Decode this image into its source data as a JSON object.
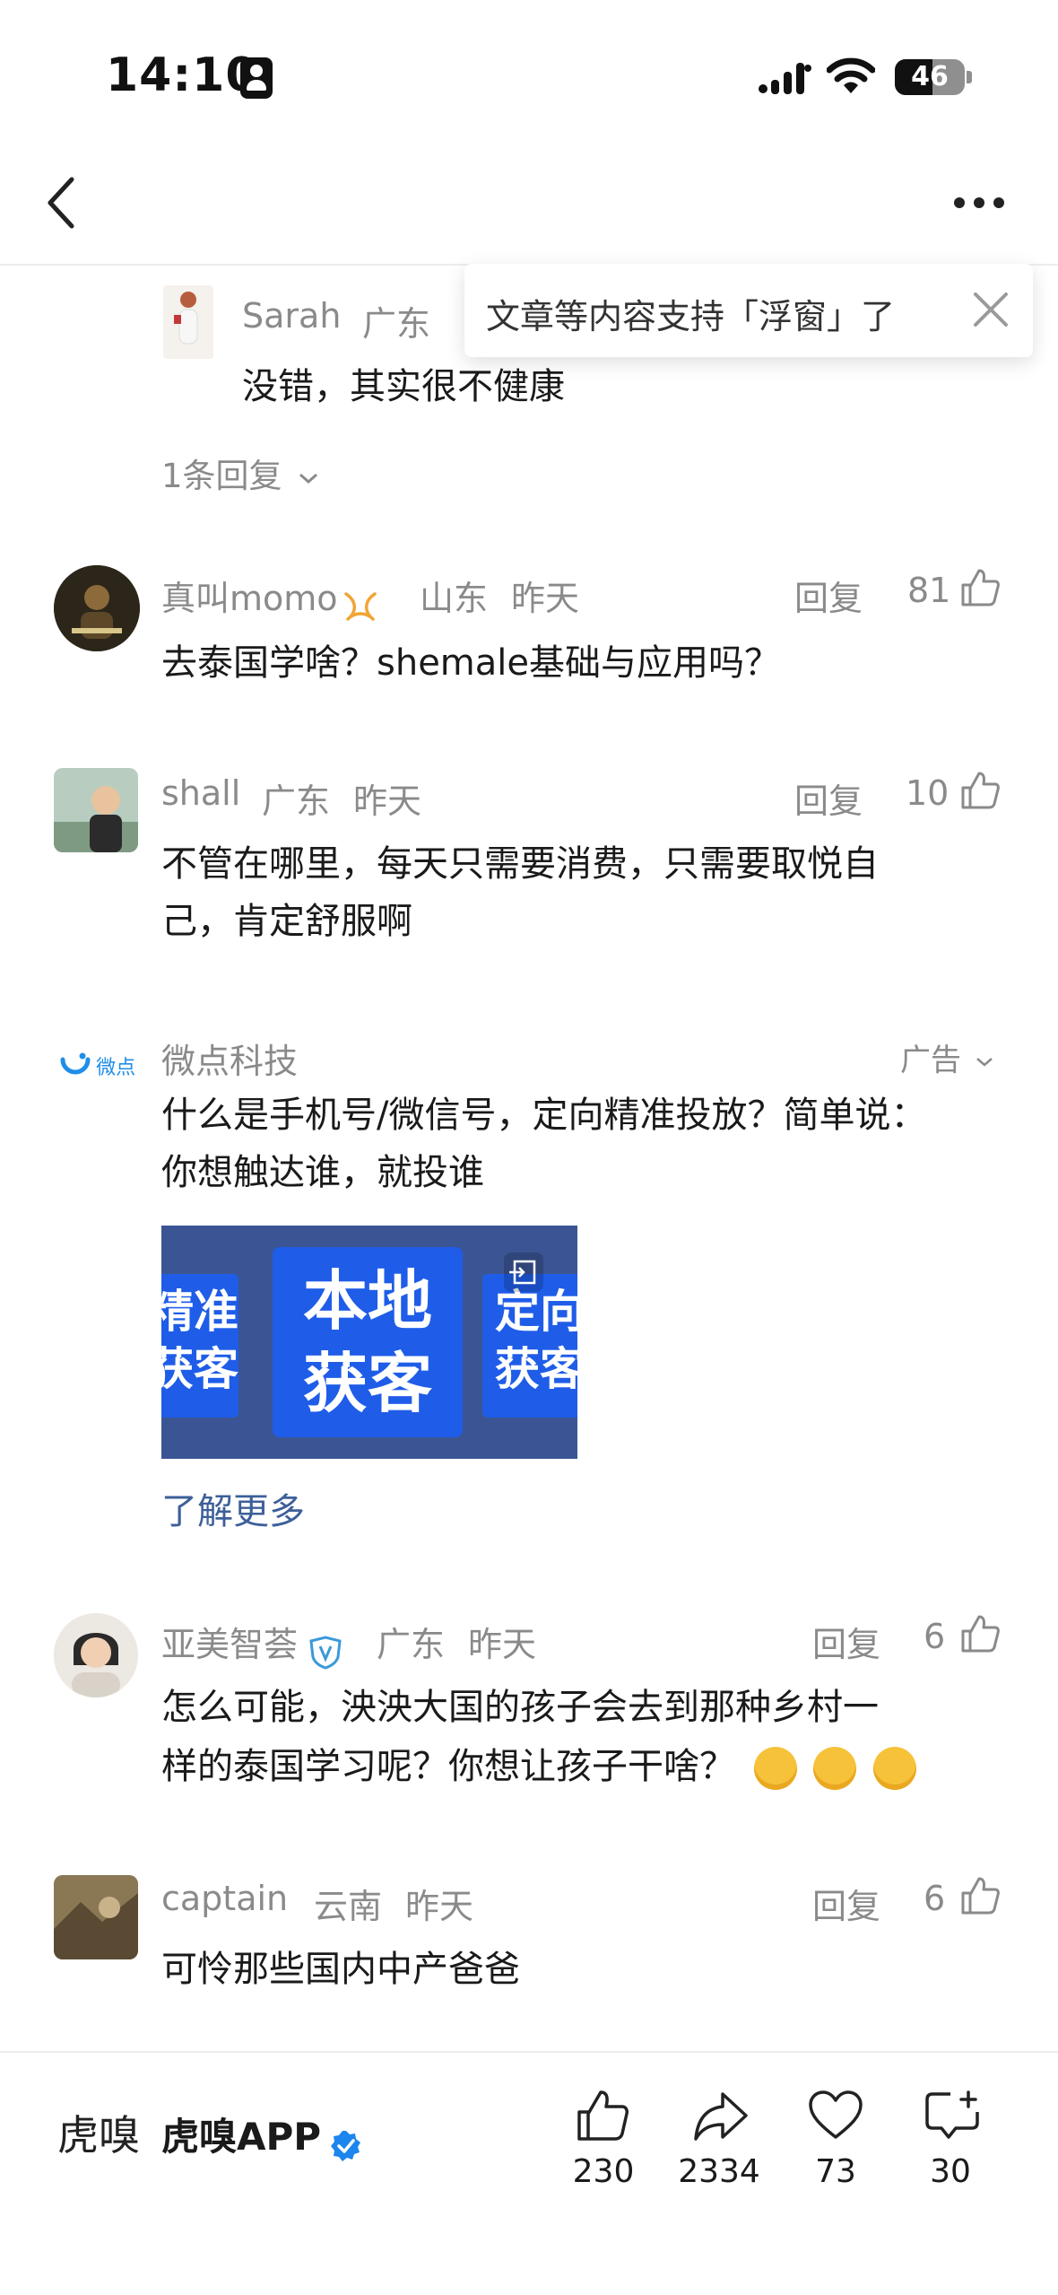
{
  "status_bar": {
    "time": "14:10",
    "battery": "46"
  },
  "toast": {
    "text": "文章等内容支持「浮窗」了"
  },
  "sub_reply": {
    "user": "Sarah",
    "location": "广东",
    "text": "没错，其实很不健康",
    "more_replies": "1条回复"
  },
  "comments": [
    {
      "user": "真叫momo",
      "location": "山东",
      "time": "昨天",
      "reply_label": "回复",
      "likes": "81",
      "text": "去泰国学啥？shemale基础与应用吗？"
    },
    {
      "user": "shall",
      "location": "广东",
      "time": "昨天",
      "reply_label": "回复",
      "likes": "10",
      "text_lines": [
        "不管在哪里，每天只需要消费，只需要取悦自",
        "己，肯定舒服啊"
      ]
    },
    {
      "user": "亚美智荟",
      "location": "广东",
      "time": "昨天",
      "reply_label": "回复",
      "likes": "6",
      "text_lines": [
        "怎么可能，泱泱大国的孩子会去到那种乡村一",
        "样的泰国学习呢？你想让孩子干啥？"
      ]
    },
    {
      "user": "captain",
      "location": "云南",
      "time": "昨天",
      "reply_label": "回复",
      "likes": "6",
      "text": "可怜那些国内中产爸爸"
    }
  ],
  "ad": {
    "logo_text": "微点",
    "advertiser": "微点科技",
    "ad_label": "广告",
    "text_lines": [
      "什么是手机号/微信号，定向精准投放？简单说：",
      "你想触达谁，就投谁"
    ],
    "banner": {
      "left": [
        "精准",
        "获客"
      ],
      "center": [
        "本地",
        "获客"
      ],
      "right": [
        "定向",
        "获客"
      ]
    },
    "learn_more": "了解更多"
  },
  "bottom_bar": {
    "publisher_logo": "虎嗅",
    "publisher": "虎嗅APP",
    "like_count": "230",
    "share_count": "2334",
    "favorite_count": "73",
    "comment_count": "30"
  },
  "colors": {
    "link": "#3d5f99",
    "ad_blue": "#1f5de8",
    "verified": "#1c86ee"
  }
}
